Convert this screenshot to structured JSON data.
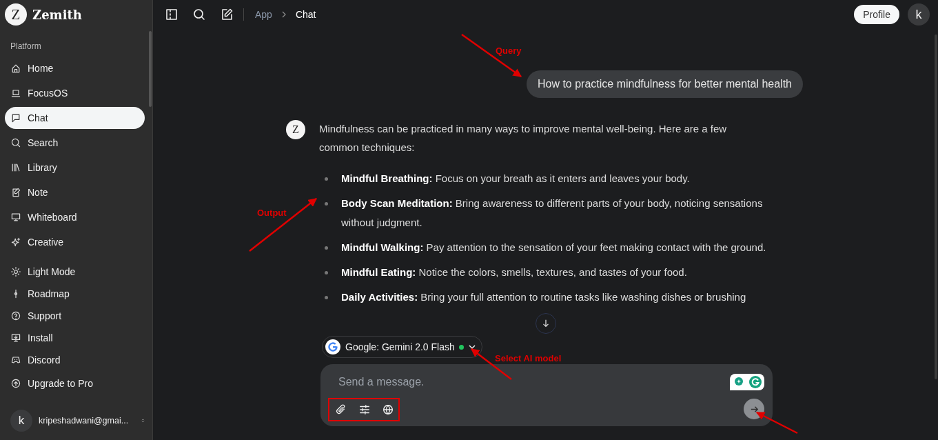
{
  "app": {
    "name": "Zemith",
    "logo_mark": "Z"
  },
  "sidebar": {
    "section_label": "Platform",
    "items": [
      {
        "label": "Home",
        "selected": false
      },
      {
        "label": "FocusOS",
        "selected": false
      },
      {
        "label": "Chat",
        "selected": true
      },
      {
        "label": "Search",
        "selected": false
      },
      {
        "label": "Library",
        "selected": false
      },
      {
        "label": "Note",
        "selected": false
      },
      {
        "label": "Whiteboard",
        "selected": false
      },
      {
        "label": "Creative",
        "selected": false
      }
    ],
    "footer_items": [
      {
        "label": "Light Mode"
      },
      {
        "label": "Roadmap"
      },
      {
        "label": "Support"
      },
      {
        "label": "Install"
      },
      {
        "label": "Discord"
      },
      {
        "label": "Upgrade to Pro"
      }
    ],
    "account": {
      "avatar": "k",
      "email": "kripeshadwani@gmai..."
    }
  },
  "topbar": {
    "breadcrumb": [
      {
        "label": "App",
        "selected": false
      },
      {
        "label": "Chat",
        "selected": true
      }
    ],
    "profile_button": "Profile",
    "avatar": "k"
  },
  "chat": {
    "bot_mark": "Z",
    "query": "How to practice mindfulness for better mental health",
    "intro": "Mindfulness can be practiced in many ways to improve mental well-being. Here are a few common techniques:",
    "items": [
      "**Mindful Breathing:** Focus on your breath as it enters and leaves your body.",
      "**Body Scan Meditation:** Bring awareness to different parts of your body, noticing sensations without judgment.",
      "**Mindful Walking:** Pay attention to the sensation of your feet making contact with the ground.",
      "**Mindful Eating:** Notice the colors, smells, textures, and tastes of your food.",
      "**Daily Activities:** Bring your full attention to routine tasks like washing dishes or brushing"
    ]
  },
  "composer": {
    "model": {
      "label": "Google: Gemini 2.0 Flash",
      "online": true
    },
    "placeholder": "Send a message."
  },
  "annotations": [
    {
      "label": "Query"
    },
    {
      "label": "Output"
    },
    {
      "label": "Select AI model"
    }
  ]
}
